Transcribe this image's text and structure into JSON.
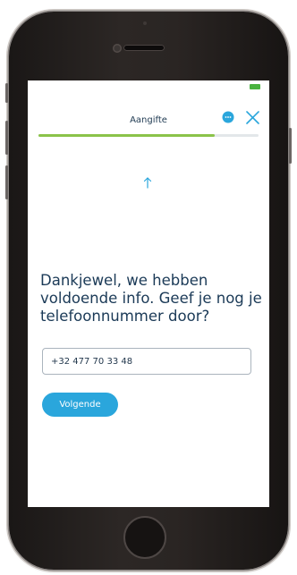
{
  "header": {
    "title": "Aangifte",
    "chat_icon": "chat-bubble-icon",
    "close_icon": "close-icon"
  },
  "status_bar": {
    "battery_icon": "battery-icon"
  },
  "progress": {
    "value": 0.8
  },
  "main": {
    "up_icon": "up-arrow-icon",
    "question": "Dankjewel, we hebben voldoende info. Geef je nog je telefoonnummer door?",
    "phone_field": {
      "value": "+32 477 70 33 48"
    },
    "next_label": "Volgende"
  },
  "colors": {
    "accent": "#2aa6dc",
    "progress": "#8bc34a",
    "text": "#1b3a57",
    "battery": "#4ab33f"
  }
}
